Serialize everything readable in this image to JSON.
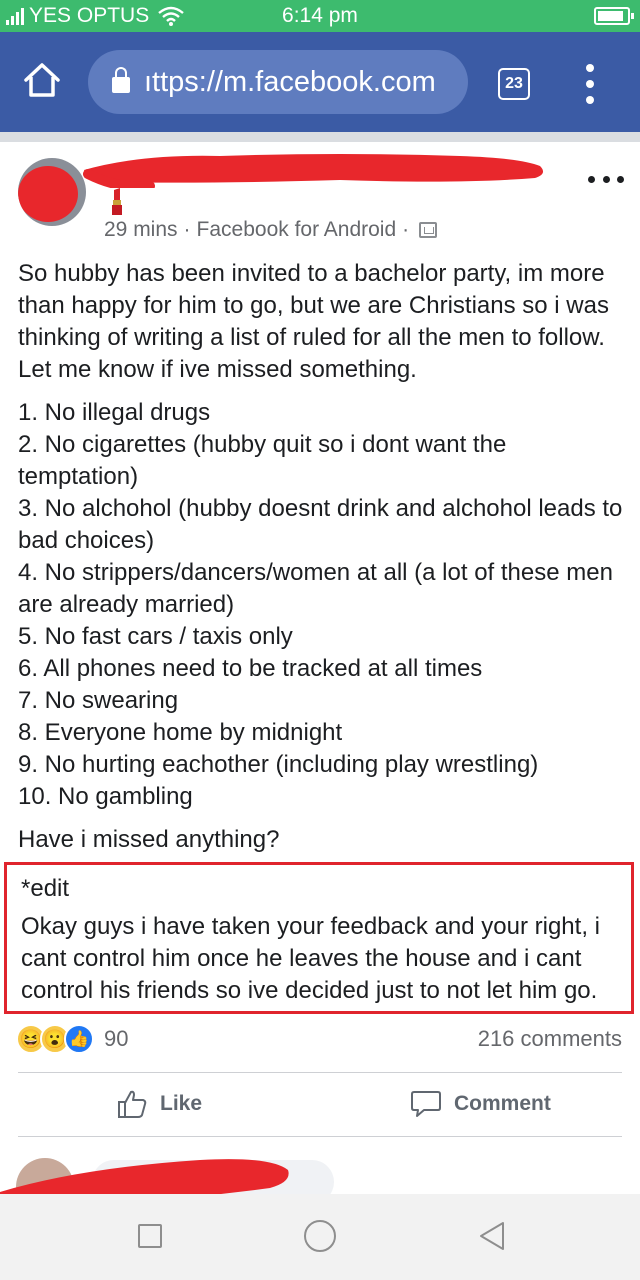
{
  "status_bar": {
    "carrier": "YES OPTUS",
    "time": "6:14 pm",
    "battery_level": 0.9,
    "icons": [
      "signal-icon",
      "wifi-icon",
      "battery-icon"
    ]
  },
  "browser": {
    "url": "ıttps://m.facebook.com",
    "tab_count": "23",
    "icons": [
      "home-icon",
      "lock-icon",
      "tabs-icon",
      "overflow-menu-icon"
    ]
  },
  "post": {
    "meta_time": "29 mins",
    "meta_separator": "·",
    "meta_source": "Facebook for Android",
    "meta_separator_2": "·",
    "intro": "So hubby has been invited to a bachelor party, im more than happy for him to go, but we are Christians so i was thinking of writing a list of ruled for all the men to follow. Let me know if ive missed something.",
    "rules": [
      "1. No illegal drugs",
      "2. No cigarettes (hubby quit so i dont want the temptation)",
      "3. No alchohol (hubby doesnt drink and alchohol leads to bad choices)",
      "4. No strippers/dancers/women at all (a lot of these men are already married)",
      "5. No fast cars / taxis only",
      "6. All phones need to be tracked at all times",
      "7. No swearing",
      "8. Everyone home by midnight",
      "9. No hurting eachother (including play wrestling)",
      "10. No gambling"
    ],
    "question": "Have i missed anything?",
    "edit_label": "*edit",
    "edit_text": "Okay guys i have taken your feedback and your right, i cant control him once he leaves the house and i cant control his friends so ive decided just to not let him go."
  },
  "engagement": {
    "reaction_count": "90",
    "comment_count": "216 comments",
    "reaction_icons": [
      "haha-reaction-icon",
      "wow-reaction-icon",
      "like-reaction-icon"
    ]
  },
  "actions": {
    "like_label": "Like",
    "comment_label": "Comment"
  },
  "colors": {
    "status_bar": "#3dbb6e",
    "browser_bar": "#3b5ba5",
    "redaction": "#e8272c",
    "edit_border": "#e0242d"
  }
}
